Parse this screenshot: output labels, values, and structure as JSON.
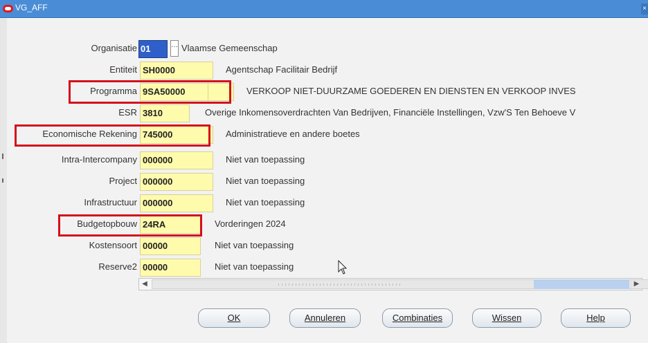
{
  "window": {
    "title": "VG_AFF",
    "close_glyph": "×"
  },
  "rows": [
    {
      "label": "Organisatie",
      "value": "01",
      "description": "Vlaamse Gemeenschap",
      "highlighted": false
    },
    {
      "label": "Entiteit",
      "value": "SH0000",
      "description": "Agentschap Facilitair Bedrijf",
      "highlighted": false
    },
    {
      "label": "Programma",
      "value": "9SA50000",
      "description": "VERKOOP NIET-DUURZAME GOEDEREN EN DIENSTEN EN VERKOOP INVES",
      "highlighted": true
    },
    {
      "label": "ESR",
      "value": "3810",
      "description": "Overige Inkomensoverdrachten Van Bedrijven, Financiële Instellingen, Vzw'S Ten Behoeve V",
      "highlighted": false
    },
    {
      "label": "Economische Rekening",
      "value": "745000",
      "description": "Administratieve en andere boetes",
      "highlighted": true
    },
    {
      "label": "Intra-Intercompany",
      "value": "000000",
      "description": "Niet van toepassing",
      "highlighted": false
    },
    {
      "label": "Project",
      "value": "000000",
      "description": "Niet van toepassing",
      "highlighted": false
    },
    {
      "label": "Infrastructuur",
      "value": "000000",
      "description": "Niet van toepassing",
      "highlighted": false
    },
    {
      "label": "Budgetopbouw",
      "value": "24RA",
      "description": "Vorderingen 2024",
      "highlighted": true
    },
    {
      "label": "Kostensoort",
      "value": "00000",
      "description": "Niet van toepassing",
      "highlighted": false
    },
    {
      "label": "Reserve2",
      "value": "00000",
      "description": "Niet van toepassing",
      "highlighted": false
    }
  ],
  "buttons": {
    "ok": "OK",
    "cancel": "Annuleren",
    "combinations": "Combinaties",
    "clear": "Wissen",
    "help": "Help"
  },
  "colors": {
    "titlebar": "#4a8dd6",
    "field": "#fffbad",
    "highlight": "#d40f1b",
    "selected_field": "#2f60c9"
  },
  "icons": {
    "logo": "oracle-logo-icon",
    "lov": "ellipsis-icon",
    "close": "close-icon",
    "cursor": "mouse-pointer-icon"
  }
}
